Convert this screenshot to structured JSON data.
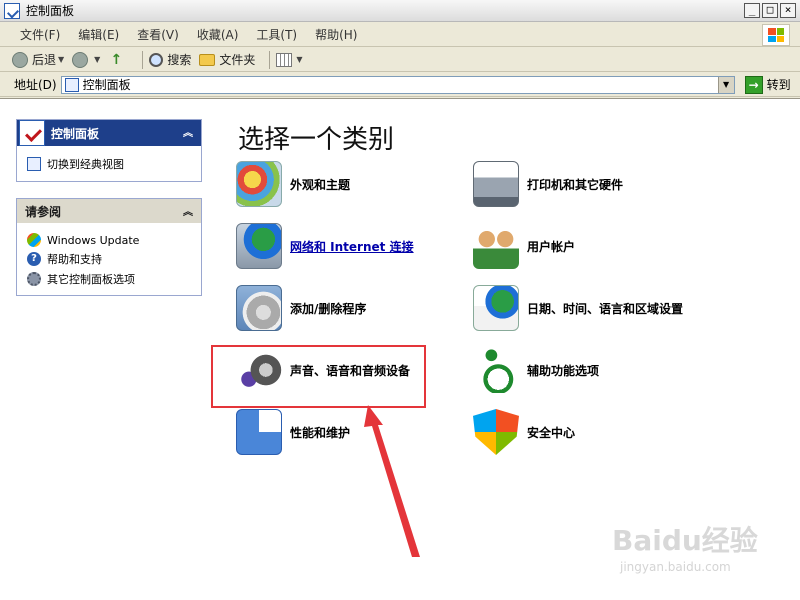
{
  "window": {
    "title": "控制面板",
    "buttons": [
      "_",
      "□",
      "×"
    ]
  },
  "menubar": {
    "items": [
      "文件(F)",
      "编辑(E)",
      "查看(V)",
      "收藏(A)",
      "工具(T)",
      "帮助(H)"
    ]
  },
  "toolbar": {
    "back_label": "后退",
    "search_label": "搜索",
    "folders_label": "文件夹"
  },
  "addressbar": {
    "label": "地址(D)",
    "value": "控制面板",
    "go_label": "转到"
  },
  "left_panel": {
    "control_panel": {
      "title": "控制面板",
      "links": [
        "切换到经典视图"
      ]
    },
    "see_also": {
      "title": "请参阅",
      "links": [
        "Windows Update",
        "帮助和支持",
        "其它控制面板选项"
      ]
    }
  },
  "main": {
    "title": "选择一个类别",
    "categories": [
      {
        "label": "外观和主题",
        "icon": "appearance-icon"
      },
      {
        "label": "打印机和其它硬件",
        "icon": "printer-icon"
      },
      {
        "label": "网络和 Internet 连接",
        "icon": "network-icon"
      },
      {
        "label": "用户帐户",
        "icon": "users-icon"
      },
      {
        "label": "添加/删除程序",
        "icon": "add-remove-icon"
      },
      {
        "label": "日期、时间、语言和区域设置",
        "icon": "datetime-icon"
      },
      {
        "label": "声音、语音和音频设备",
        "icon": "sound-icon"
      },
      {
        "label": "辅助功能选项",
        "icon": "accessibility-icon"
      },
      {
        "label": "性能和维护",
        "icon": "performance-icon"
      },
      {
        "label": "安全中心",
        "icon": "security-icon"
      }
    ]
  },
  "colors": {
    "highlight": "#e4353a",
    "panel_header": "#1e3f8a"
  },
  "watermark": {
    "brand": "Baidu经验",
    "url": "jingyan.baidu.com"
  }
}
